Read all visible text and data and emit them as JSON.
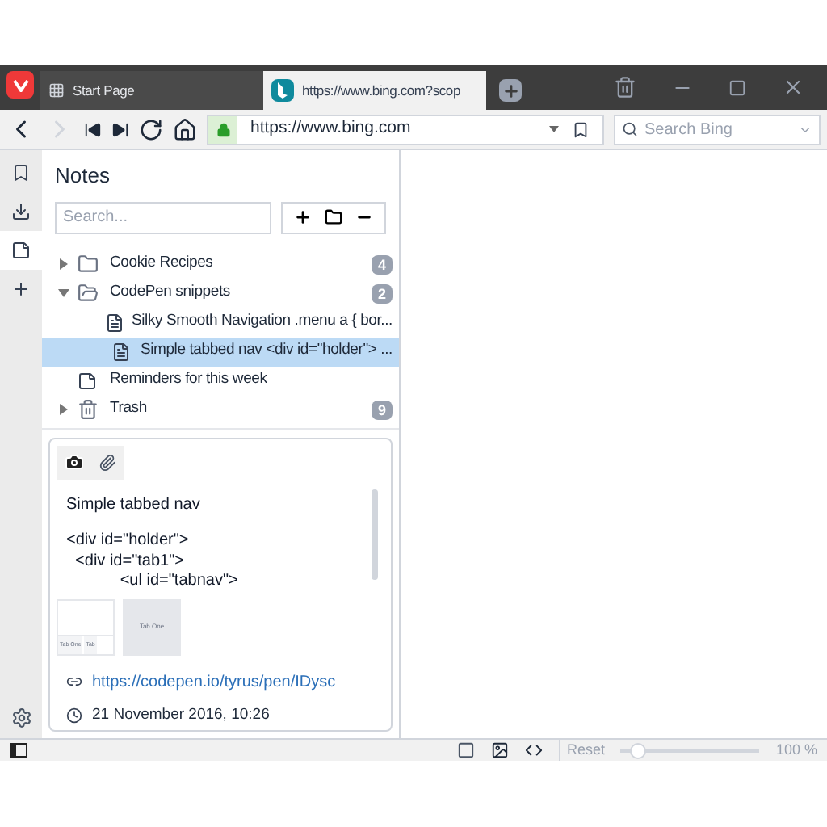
{
  "tabs": [
    {
      "title": "Start Page",
      "selected": false,
      "kind": "grid"
    },
    {
      "title": "https://www.bing.com?scop",
      "selected": true,
      "kind": "bing"
    }
  ],
  "address_bar": {
    "url": "https://www.bing.com",
    "secure": true
  },
  "search": {
    "placeholder": "Search Bing"
  },
  "side_panel": {
    "buttons": [
      {
        "kind": "bookmarks",
        "selected": false
      },
      {
        "kind": "downloads",
        "selected": false
      },
      {
        "kind": "notes",
        "selected": true
      },
      {
        "kind": "add",
        "selected": false
      }
    ]
  },
  "notes": {
    "title": "Notes",
    "search_placeholder": "Search...",
    "tree": [
      {
        "kind": "folder",
        "label": "Cookie Recipes",
        "count": "4",
        "expanded": false,
        "selected": false
      },
      {
        "kind": "folder",
        "label": "CodePen snippets",
        "count": "2",
        "expanded": true,
        "selected": false,
        "children": [
          {
            "kind": "note-attach",
            "label": "Silky Smooth Navigation .menu a { bor...",
            "selected": false
          },
          {
            "kind": "note-attach",
            "label": "Simple tabbed nav <div id=\"holder\"> ...",
            "selected": true
          }
        ]
      },
      {
        "kind": "note",
        "label": "Reminders for this week",
        "selected": false
      },
      {
        "kind": "trash",
        "label": "Trash",
        "count": "9",
        "expanded": false,
        "selected": false
      }
    ],
    "detail": {
      "title": "Simple tabbed nav",
      "lines": [
        "<div id=\"holder\">",
        "  <div id=\"tab1\">",
        "            <ul id=\"tabnav\">"
      ],
      "thumbnails": [
        {
          "texts": [
            "Tab One",
            "Tab"
          ]
        },
        {
          "texts": [
            "Tab One"
          ]
        }
      ],
      "link": "https://codepen.io/tyrus/pen/IDysc",
      "date": "21 November 2016, 10:26"
    }
  },
  "status_bar": {
    "reset": "Reset",
    "zoom": {
      "level": 0.12
    },
    "zoom_reading": "100 %"
  }
}
